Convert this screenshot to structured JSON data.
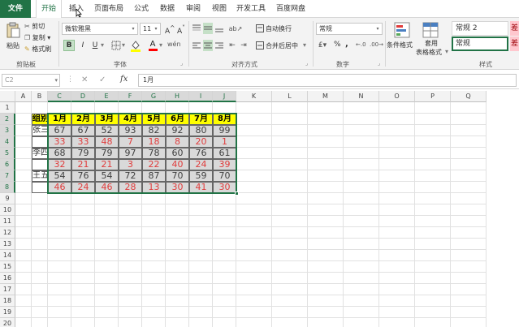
{
  "tabs": [
    {
      "label": "文件"
    },
    {
      "label": "开始"
    },
    {
      "label": "插入"
    },
    {
      "label": "页面布局"
    },
    {
      "label": "公式"
    },
    {
      "label": "数据"
    },
    {
      "label": "审阅"
    },
    {
      "label": "视图"
    },
    {
      "label": "开发工具"
    },
    {
      "label": "百度网盘"
    }
  ],
  "ribbon": {
    "clipboard": {
      "paste": "粘贴",
      "cut": "剪切",
      "copy": "复制",
      "format_painter": "格式刷",
      "label": "剪贴板"
    },
    "font": {
      "name": "微软雅黑",
      "size": "11",
      "label": "字体",
      "bold": "B",
      "italic": "I",
      "underline": "U"
    },
    "alignment": {
      "wrap": "自动换行",
      "merge": "合并后居中",
      "label": "对齐方式"
    },
    "number": {
      "format": "常规",
      "percent": "%",
      "comma": ",",
      "label": "数字"
    },
    "styles": {
      "conditional": "条件格式",
      "table_format_1": "套用",
      "table_format_2": "表格格式",
      "style1": "常规 2",
      "style2": "常规",
      "style3": "差",
      "label": "样式"
    },
    "colors": {
      "accent": "#217346",
      "font_red": "#ff0000",
      "fill_yellow": "#ffff00"
    }
  },
  "formula_bar": {
    "name_box": "C2",
    "fx": "fx",
    "content": "1月"
  },
  "columns": [
    "A",
    "B",
    "C",
    "D",
    "E",
    "F",
    "G",
    "H",
    "I",
    "J",
    "K",
    "L",
    "M",
    "N",
    "O",
    "P",
    "Q"
  ],
  "rows": [
    "1",
    "2",
    "3",
    "4",
    "5",
    "6",
    "7",
    "8",
    "9",
    "10",
    "11",
    "12",
    "13",
    "14",
    "15",
    "16",
    "17",
    "18",
    "19",
    "20"
  ],
  "table": {
    "header": [
      "组别",
      "1月",
      "2月",
      "3月",
      "4月",
      "5月",
      "6月",
      "7月",
      "8月"
    ],
    "groups": [
      {
        "name": "张三",
        "top": [
          "67",
          "67",
          "52",
          "93",
          "82",
          "92",
          "80",
          "99"
        ],
        "bottom": [
          "33",
          "33",
          "48",
          "7",
          "18",
          "8",
          "20",
          "1"
        ]
      },
      {
        "name": "李四",
        "top": [
          "68",
          "79",
          "79",
          "97",
          "78",
          "60",
          "76",
          "61"
        ],
        "bottom": [
          "32",
          "21",
          "21",
          "3",
          "22",
          "40",
          "24",
          "39"
        ]
      },
      {
        "name": "王五",
        "top": [
          "54",
          "76",
          "54",
          "72",
          "87",
          "70",
          "59",
          "70"
        ],
        "bottom": [
          "46",
          "24",
          "46",
          "28",
          "13",
          "30",
          "41",
          "30"
        ]
      }
    ]
  }
}
